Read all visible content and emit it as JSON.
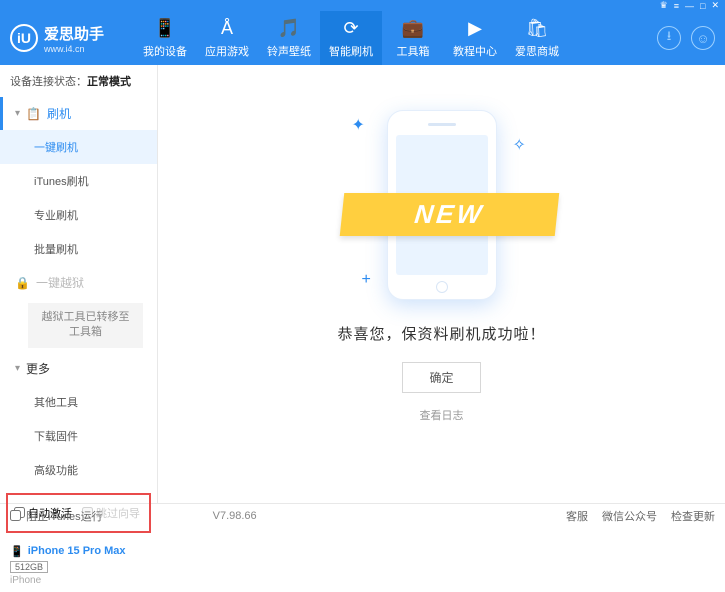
{
  "titlebar": {
    "gift": "♛",
    "menu": "≡",
    "min": "—",
    "max": "□",
    "close": "✕"
  },
  "logo": {
    "badge": "iU",
    "title": "爱思助手",
    "subtitle": "www.i4.cn"
  },
  "nav": [
    {
      "icon": "📱",
      "label": "我的设备"
    },
    {
      "icon": "Å",
      "label": "应用游戏"
    },
    {
      "icon": "🎵",
      "label": "铃声壁纸"
    },
    {
      "icon": "⟳",
      "label": "智能刷机",
      "active": true
    },
    {
      "icon": "💼",
      "label": "工具箱"
    },
    {
      "icon": "▶",
      "label": "教程中心"
    },
    {
      "icon": "🛍",
      "label": "爱思商城"
    }
  ],
  "status": {
    "label": "设备连接状态：",
    "value": "正常模式"
  },
  "sidebar": {
    "flash": {
      "header": "刷机",
      "items": [
        "一键刷机",
        "iTunes刷机",
        "专业刷机",
        "批量刷机"
      ]
    },
    "jailbreak": {
      "header": "一键越狱",
      "notice": "越狱工具已转移至工具箱"
    },
    "more": {
      "header": "更多",
      "items": [
        "其他工具",
        "下载固件",
        "高级功能"
      ]
    }
  },
  "checkboxes": {
    "auto_activate": "自动激活",
    "skip_guide": "跳过向导"
  },
  "device": {
    "name": "iPhone 15 Pro Max",
    "capacity": "512GB",
    "type": "iPhone"
  },
  "main": {
    "ribbon": "NEW",
    "success": "恭喜您，保资料刷机成功啦！",
    "ok": "确定",
    "log": "查看日志"
  },
  "footer": {
    "block_itunes": "阻止iTunes运行",
    "version": "V7.98.66",
    "links": [
      "客服",
      "微信公众号",
      "检查更新"
    ]
  }
}
